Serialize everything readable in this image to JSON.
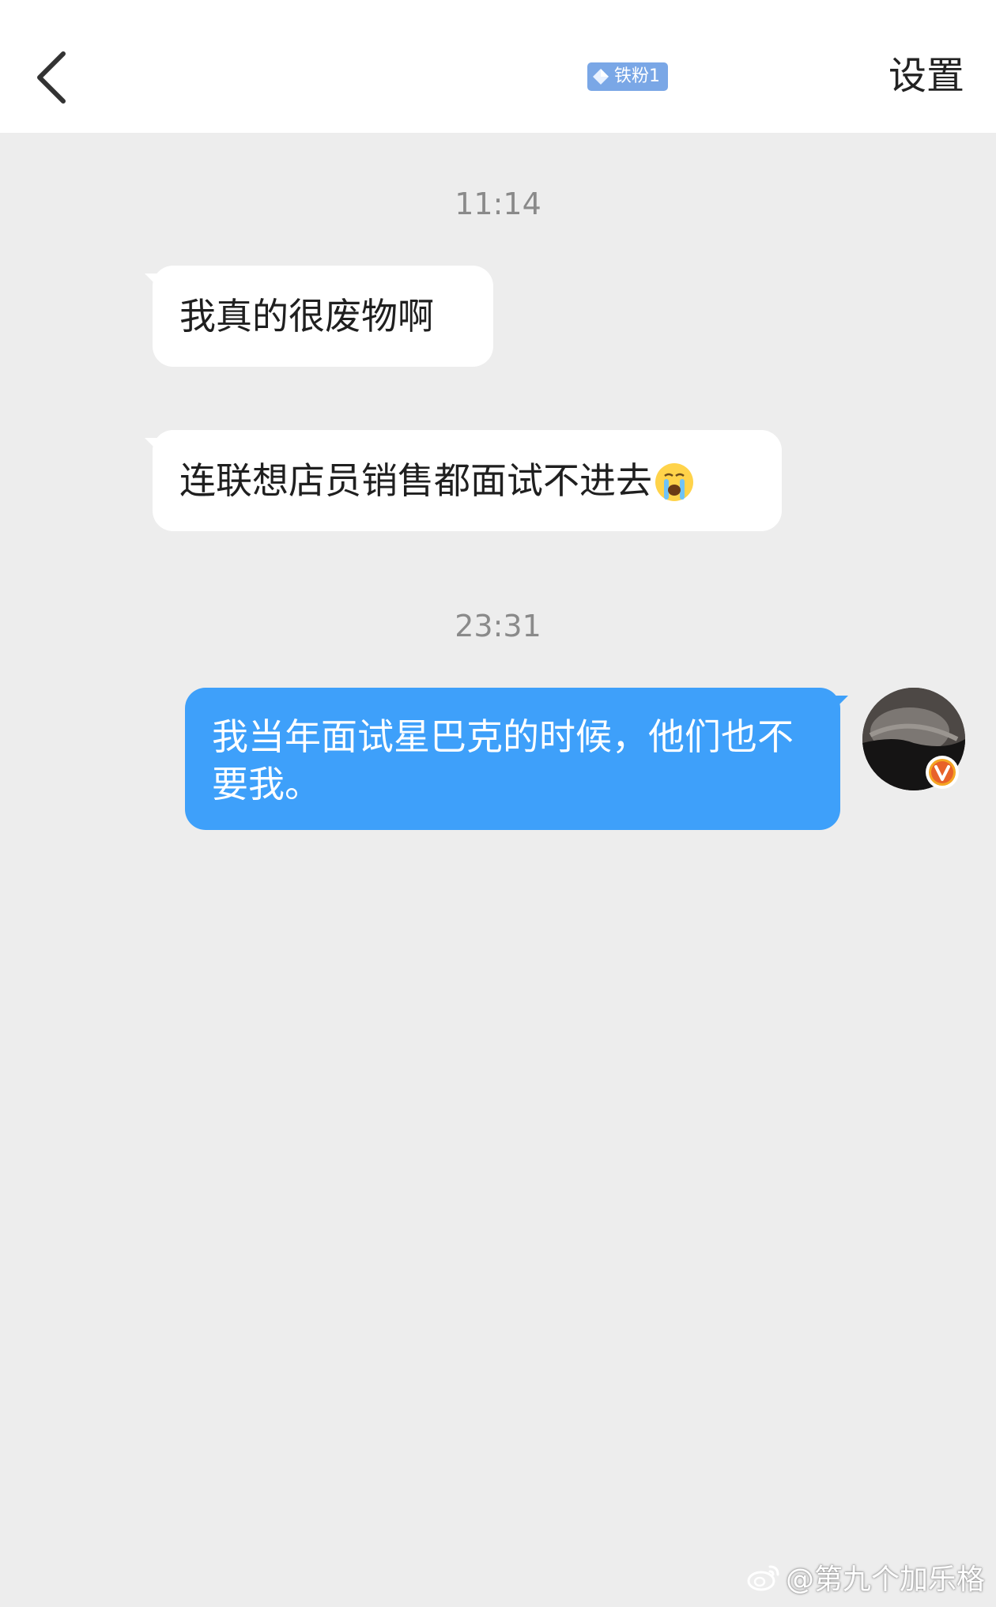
{
  "header": {
    "back_icon": "chevron-left-icon",
    "fan_badge_label": "铁粉1",
    "fan_badge_icon": "diamond-icon",
    "settings_label": "设置"
  },
  "messages": [
    {
      "type": "timestamp",
      "text": "11:14"
    },
    {
      "type": "incoming",
      "text": "我真的很废物啊"
    },
    {
      "type": "incoming",
      "text": "连联想店员销售都面试不进去",
      "emoji": "crying-face-icon"
    },
    {
      "type": "timestamp",
      "text": "23:31"
    },
    {
      "type": "outgoing",
      "text": "我当年面试星巴克的时候，他们也不要我。"
    }
  ],
  "watermark": {
    "text": "@第九个加乐格",
    "icon": "weibo-logo-icon"
  },
  "colors": {
    "background": "#ededed",
    "outgoing_bubble": "#3ea0fa",
    "incoming_bubble": "#ffffff",
    "badge": "#7aa7e6",
    "verified": "#f5a623"
  }
}
